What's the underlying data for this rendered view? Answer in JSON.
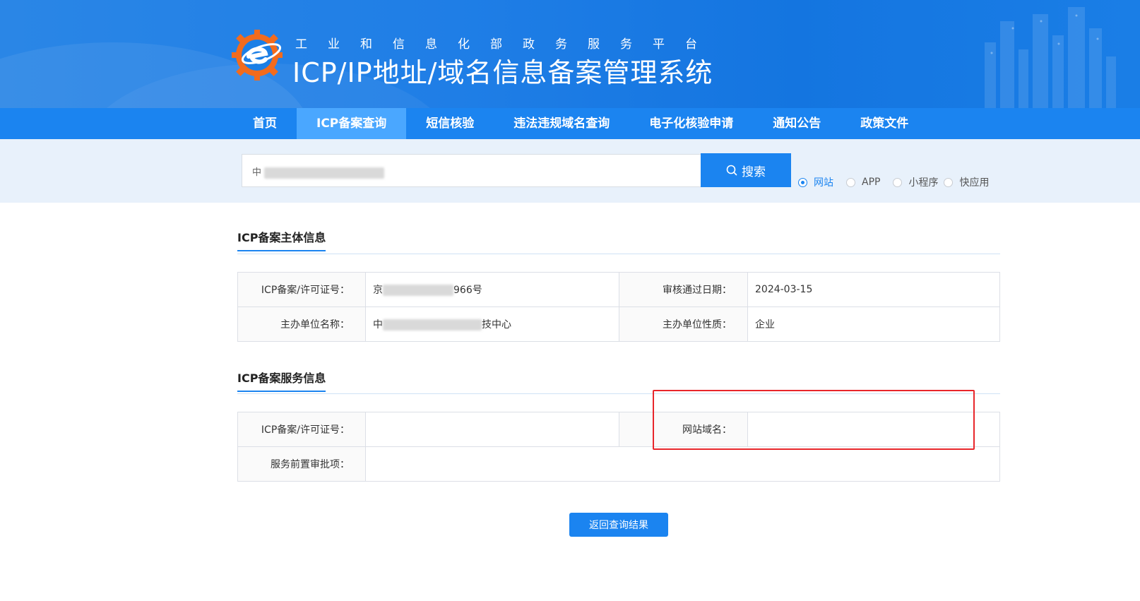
{
  "header": {
    "subtitle": "工业和信息化部政务服务平台",
    "title": "ICP/IP地址/域名信息备案管理系统"
  },
  "nav": {
    "items": [
      {
        "label": "首页",
        "active": false
      },
      {
        "label": "ICP备案查询",
        "active": true
      },
      {
        "label": "短信核验",
        "active": false
      },
      {
        "label": "违法违规域名查询",
        "active": false
      },
      {
        "label": "电子化核验申请",
        "active": false
      },
      {
        "label": "通知公告",
        "active": false
      },
      {
        "label": "政策文件",
        "active": false
      }
    ]
  },
  "search": {
    "value_visible": "中",
    "button_label": "搜索",
    "options": [
      {
        "label": "网站",
        "checked": true
      },
      {
        "label": "APP",
        "checked": false
      },
      {
        "label": "小程序",
        "checked": false
      },
      {
        "label": "快应用",
        "checked": false
      }
    ]
  },
  "subject_section": {
    "title": "ICP备案主体信息",
    "rows": [
      {
        "label1": "ICP备案/许可证号：",
        "value1_prefix": "京",
        "value1_suffix": "966号",
        "label2": "审核通过日期：",
        "value2": "2024-03-15"
      },
      {
        "label1": "主办单位名称：",
        "value1_prefix": "中",
        "value1_suffix": "技中心",
        "label2": "主办单位性质：",
        "value2": "企业"
      }
    ]
  },
  "service_section": {
    "title": "ICP备案服务信息",
    "row1": {
      "label1": "ICP备案/许可证号：",
      "value1": "",
      "label2": "网站域名：",
      "value2": ""
    },
    "row2": {
      "label": "服务前置审批项：",
      "value": ""
    }
  },
  "footer": {
    "back_button": "返回查询结果"
  },
  "colors": {
    "primary": "#1b84f0",
    "nav_active": "#4aa7ff",
    "highlight_box": "#e8262b"
  }
}
